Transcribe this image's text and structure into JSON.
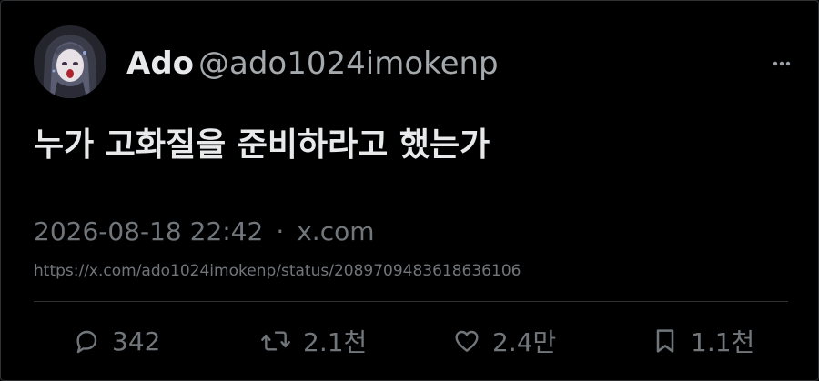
{
  "author": {
    "name": "Ado",
    "handle": "@ado1024imokenp"
  },
  "post": {
    "text": "누가 고화질을 준비하라고 했는가",
    "timestamp": "2026-08-18 22:42",
    "separator": "·",
    "source": "x.com",
    "url": "https://x.com/ado1024imokenp/status/2089709483618636106"
  },
  "actions": {
    "replies": "342",
    "reposts": "2.1천",
    "likes": "2.4만",
    "bookmarks": "1.1천"
  },
  "icons": {
    "more": "more-horizontal-icon",
    "reply": "reply-icon",
    "repost": "repost-icon",
    "like": "heart-icon",
    "bookmark": "bookmark-icon"
  },
  "colors": {
    "background": "#000000",
    "primary_text": "#e7e9ea",
    "secondary_text": "#71767b",
    "divider": "#2f3336"
  }
}
